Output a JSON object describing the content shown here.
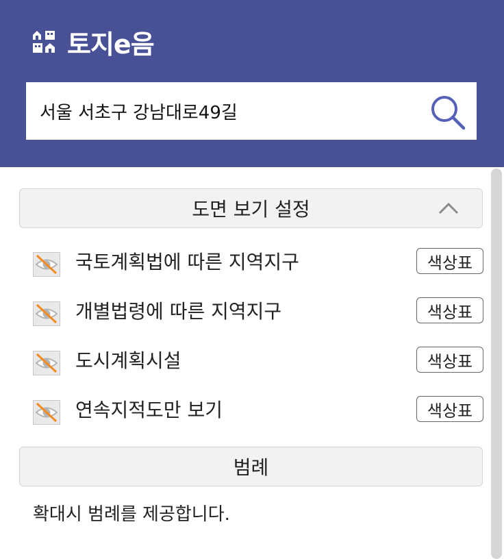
{
  "header": {
    "logo_text": "토지e음",
    "search": {
      "value": "서울 서초구 강남대로49길",
      "placeholder": ""
    }
  },
  "map_settings": {
    "title": "도면 보기 설정",
    "expanded": true,
    "layers": [
      {
        "label": "국토계획법에 따른 지역지구",
        "visible": false,
        "button": "색상표"
      },
      {
        "label": "개별법령에 따른 지역지구",
        "visible": false,
        "button": "색상표"
      },
      {
        "label": "도시계획시설",
        "visible": false,
        "button": "색상표"
      },
      {
        "label": "연속지적도만 보기",
        "visible": false,
        "button": "색상표"
      }
    ]
  },
  "legend": {
    "title": "범례",
    "note": "확대시 범례를 제공합니다."
  },
  "colors": {
    "header_bg": "#485196",
    "search_icon": "#5560b8",
    "eye_off_slash": "#f28a1e",
    "section_bg": "#f2f2f2"
  }
}
